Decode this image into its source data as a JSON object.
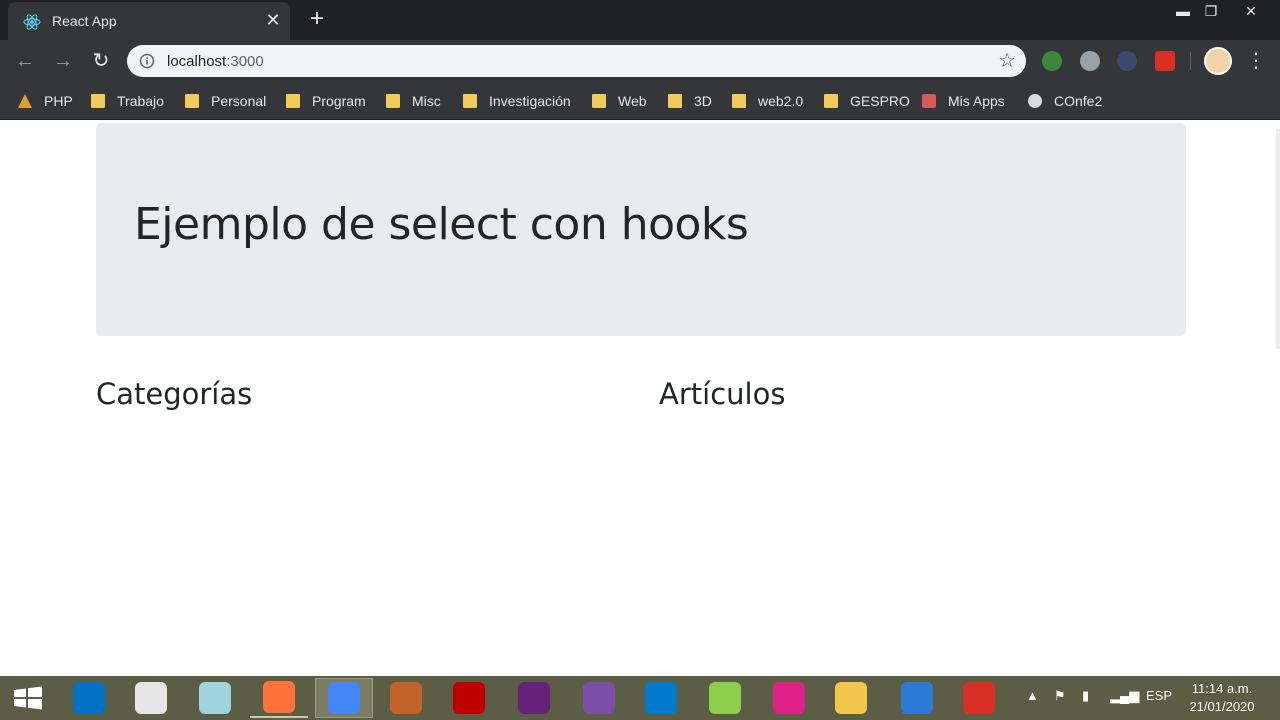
{
  "browser": {
    "tab_title": "React App",
    "url_host": "localhost",
    "url_port": ":3000",
    "bookmarks": [
      "PHP",
      "Trabajo",
      "Personal",
      "Program",
      "Misc",
      "Investigación",
      "Web",
      "3D",
      "web2.0",
      "GESPRO",
      "Mis Apps",
      "COnfe2"
    ]
  },
  "page": {
    "jumbotron_title": "Ejemplo de select con hooks",
    "column_left_title": "Categorías",
    "column_right_title": "Artículos"
  },
  "taskbar": {
    "language": "ESP",
    "time": "11:14 a.m.",
    "date": "21/01/2020",
    "apps": [
      {
        "name": "outlook-icon",
        "color": "#0072c6"
      },
      {
        "name": "scanner-icon",
        "color": "#e6e6e6"
      },
      {
        "name": "notes-icon",
        "color": "#9fd3e0"
      },
      {
        "name": "firefox-icon",
        "color": "#ff7139"
      },
      {
        "name": "chrome-icon",
        "color": "#4285f4"
      },
      {
        "name": "baseball-glove-icon",
        "color": "#c0622a"
      },
      {
        "name": "filezilla-icon",
        "color": "#bf0000"
      },
      {
        "name": "visual-studio-icon",
        "color": "#68217a"
      },
      {
        "name": "github-icon",
        "color": "#7b4fa8"
      },
      {
        "name": "vscode-icon",
        "color": "#007acc"
      },
      {
        "name": "notepad-plus-icon",
        "color": "#8ccf4d"
      },
      {
        "name": "wamp-icon",
        "color": "#e0218a"
      },
      {
        "name": "file-explorer-icon",
        "color": "#f2c54b"
      },
      {
        "name": "photos-icon",
        "color": "#2b7bd6"
      },
      {
        "name": "screen-recorder-icon",
        "color": "#d93025"
      }
    ]
  },
  "colors": {
    "chrome_dark": "#202124",
    "chrome_toolbar": "#35363a",
    "jumbotron_bg": "#e9ecef",
    "text_dark": "#212529",
    "taskbar_bg": "#5b5d45"
  }
}
